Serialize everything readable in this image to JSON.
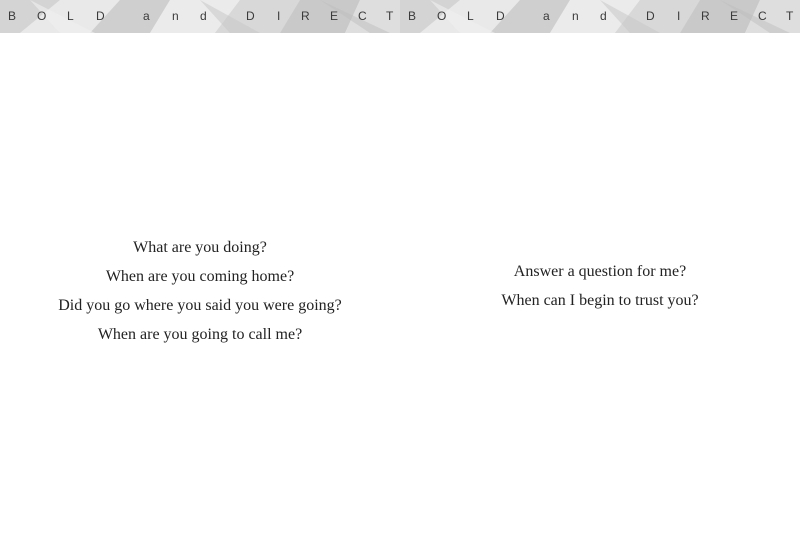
{
  "spread": {
    "left_page": {
      "banner": {
        "letters": [
          "B",
          "O",
          "L",
          "D",
          "a",
          "n",
          "d",
          "D",
          "I",
          "R",
          "E",
          "C",
          "T"
        ]
      },
      "verse": [
        "What are you doing?",
        "When are you coming home?",
        "Did you go where you said you were going?",
        "When are you going to call me?"
      ]
    },
    "right_page": {
      "banner": {
        "letters": [
          "B",
          "O",
          "L",
          "D",
          "a",
          "n",
          "d",
          "D",
          "I",
          "R",
          "E",
          "C",
          "T"
        ]
      },
      "verse": [
        "Answer a question for me?",
        "When can I begin to trust you?"
      ]
    }
  },
  "colors": {
    "banner_background": "#e2e2e2",
    "banner_text": "#3a3a3a",
    "body_text": "#222222",
    "page_background": "#ffffff"
  }
}
